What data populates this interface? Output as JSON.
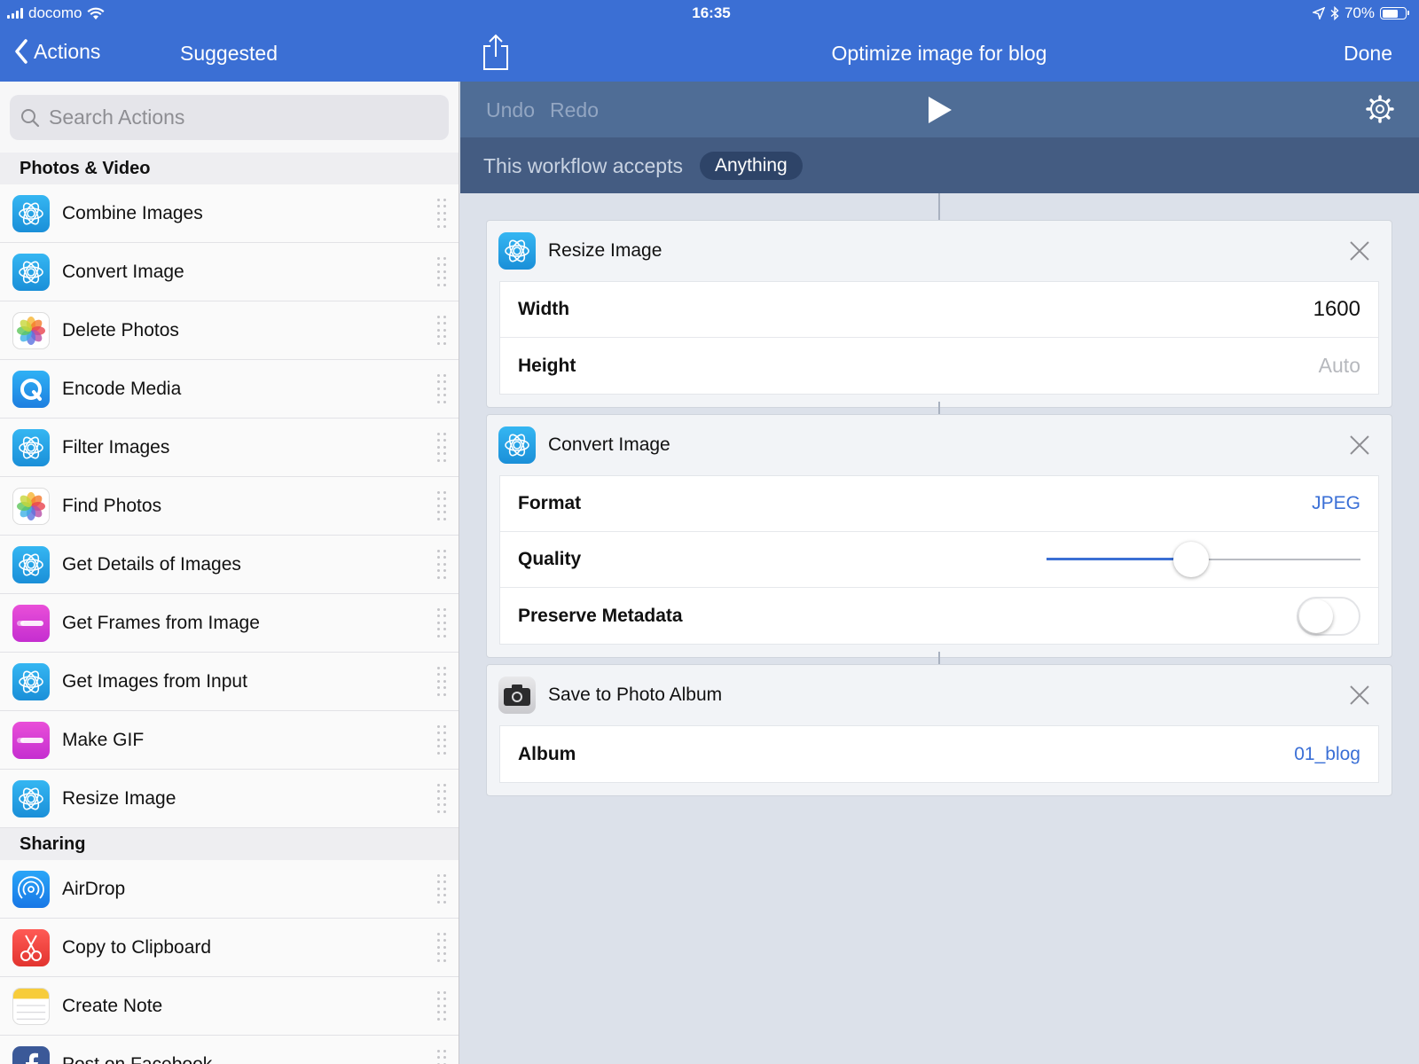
{
  "status": {
    "carrier": "docomo",
    "time": "16:35",
    "battery_text": "70%",
    "battery_level": 0.7
  },
  "nav": {
    "back_label": "Actions",
    "tab_label": "Suggested",
    "workflow_title": "Optimize image for blog",
    "done_label": "Done"
  },
  "search": {
    "placeholder": "Search Actions"
  },
  "sidebar": {
    "sections": [
      {
        "title": "Photos & Video",
        "items": [
          {
            "label": "Combine Images",
            "icon": "image-flower-icon"
          },
          {
            "label": "Convert Image",
            "icon": "image-flower-icon"
          },
          {
            "label": "Delete Photos",
            "icon": "photos-app-icon"
          },
          {
            "label": "Encode Media",
            "icon": "encode-media-icon"
          },
          {
            "label": "Filter Images",
            "icon": "image-flower-icon"
          },
          {
            "label": "Find Photos",
            "icon": "photos-app-icon"
          },
          {
            "label": "Get Details of Images",
            "icon": "image-flower-icon"
          },
          {
            "label": "Get Frames from Image",
            "icon": "gif-icon"
          },
          {
            "label": "Get Images from Input",
            "icon": "image-flower-icon"
          },
          {
            "label": "Make GIF",
            "icon": "gif-icon"
          },
          {
            "label": "Resize Image",
            "icon": "image-flower-icon"
          }
        ]
      },
      {
        "title": "Sharing",
        "items": [
          {
            "label": "AirDrop",
            "icon": "airdrop-icon"
          },
          {
            "label": "Copy to Clipboard",
            "icon": "scissors-icon"
          },
          {
            "label": "Create Note",
            "icon": "notes-icon"
          },
          {
            "label": "Post on Facebook",
            "icon": "facebook-icon"
          }
        ]
      }
    ]
  },
  "toolbar": {
    "undo_label": "Undo",
    "redo_label": "Redo"
  },
  "accepts": {
    "label": "This workflow accepts",
    "value": "Anything"
  },
  "actions": {
    "resize": {
      "title": "Resize Image",
      "width_label": "Width",
      "width_value": "1600",
      "height_label": "Height",
      "height_value": "Auto"
    },
    "convert": {
      "title": "Convert Image",
      "format_label": "Format",
      "format_value": "JPEG",
      "quality_label": "Quality",
      "quality_level": 0.46,
      "metadata_label": "Preserve Metadata",
      "metadata_on": false
    },
    "save": {
      "title": "Save to Photo Album",
      "album_label": "Album",
      "album_value": "01_blog"
    }
  },
  "colors": {
    "accent": "#3b6fd4",
    "toolbar": "#4f6d96",
    "accepts_bar": "#445c82",
    "link": "#3a6fd6"
  }
}
